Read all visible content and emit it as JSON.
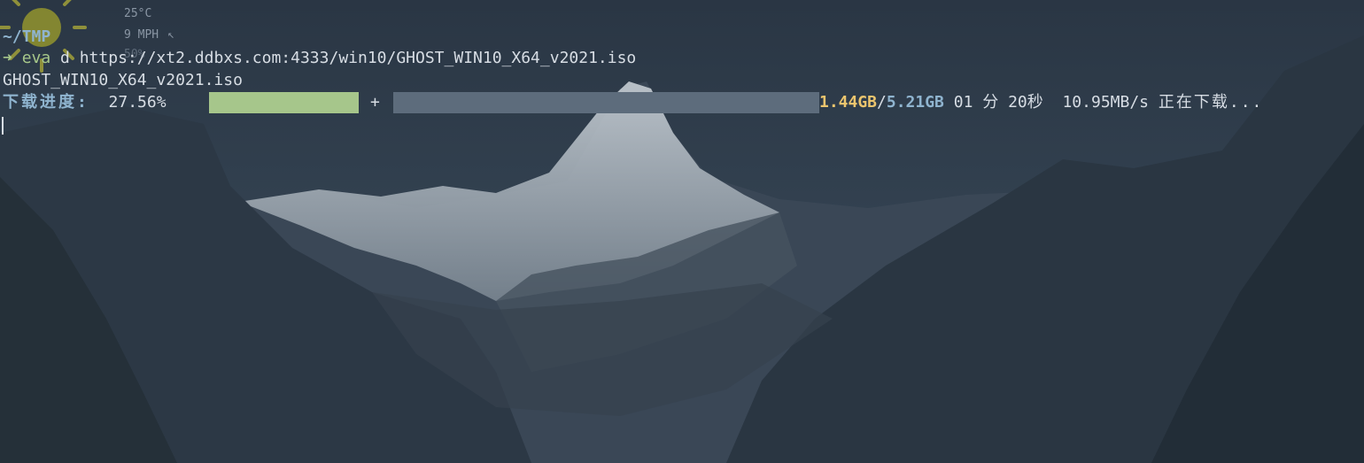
{
  "weather": {
    "temperature": "25°C",
    "wind": "9 MPH",
    "wind_arrow": "↖",
    "extra": "50%",
    "icon": "sun-icon"
  },
  "terminal": {
    "cwd": "~/TMP",
    "prompt_symbol": "➜",
    "command_name": "eva",
    "command_args": "d https://xt2.ddbxs.com:4333/win10/GHOST_WIN10_X64_v2021.iso",
    "output_filename": "GHOST_WIN10_X64_v2021.iso",
    "progress": {
      "label": "下载进度:",
      "percent_text": "27.56%",
      "percent_value": 27.56,
      "separator": "+",
      "downloaded": "1.44GB",
      "slash": "/",
      "total": "5.21GB",
      "eta": "01 分 20秒",
      "speed": "10.95MB/s",
      "status": "正在下载..."
    }
  },
  "colors": {
    "background": "#2b3745",
    "progress_done": "#a6c68b",
    "progress_remaining": "#5d6c7c",
    "downloaded": "#ecc56e",
    "total": "#8fb4cf",
    "prompt": "#a6c78a"
  }
}
